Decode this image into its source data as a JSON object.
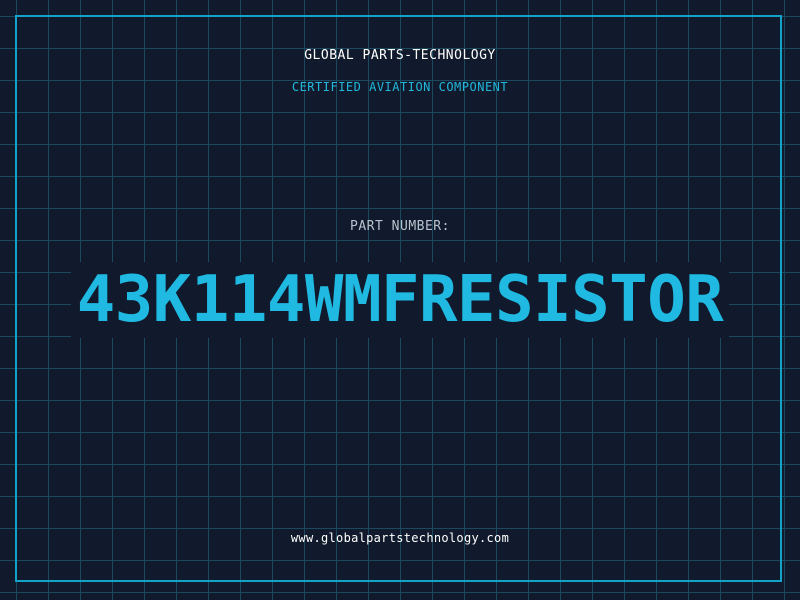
{
  "header": {
    "company": "GLOBAL PARTS-TECHNOLOGY",
    "subtitle": "CERTIFIED AVIATION COMPONENT"
  },
  "part": {
    "label": "PART NUMBER:",
    "number": "43K114WMFRESISTOR"
  },
  "footer": {
    "website": "www.globalpartstechnology.com"
  },
  "colors": {
    "background": "#101a2c",
    "grid": "#1b4a5e",
    "accent": "#1fb9e2",
    "frame": "#13a3c9"
  }
}
